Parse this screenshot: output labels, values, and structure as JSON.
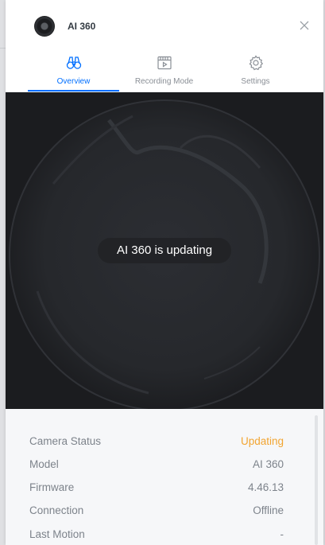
{
  "window": {
    "title": "AI 360"
  },
  "tabs": [
    {
      "label": "Overview",
      "icon": "binoculars-icon",
      "active": true
    },
    {
      "label": "Recording Mode",
      "icon": "video-file-icon",
      "active": false
    },
    {
      "label": "Settings",
      "icon": "gear-icon",
      "active": false
    }
  ],
  "camera": {
    "status_message": "AI 360 is updating"
  },
  "details": [
    {
      "label": "Camera Status",
      "value": "Updating",
      "status": "warning"
    },
    {
      "label": "Model",
      "value": "AI 360"
    },
    {
      "label": "Firmware",
      "value": "4.46.13"
    },
    {
      "label": "Connection",
      "value": "Offline"
    },
    {
      "label": "Last Motion",
      "value": "-"
    }
  ],
  "colors": {
    "accent": "#006fff",
    "warning": "#f2a532",
    "text_muted": "#7d838b"
  }
}
